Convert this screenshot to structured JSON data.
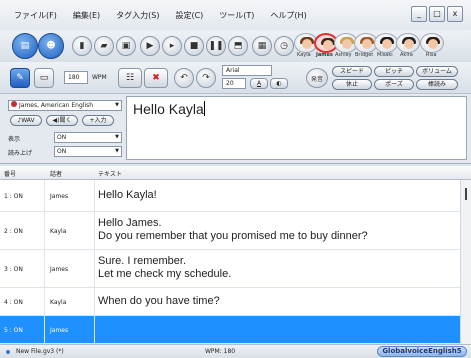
{
  "menu": [
    "ファイル(F)",
    "編集(E)",
    "タグ入力(S)",
    "設定(C)",
    "ツール(T)",
    "ヘルプ(H)"
  ],
  "window_buttons": [
    "_",
    "□",
    "x"
  ],
  "voices": [
    "Kayla",
    "James",
    "Ashley",
    "Bridget",
    "Misaki",
    "Akira",
    "Risa"
  ],
  "selected_voice": "James",
  "toolbar2": {
    "speed_value": "180",
    "wpm_label": "WPM",
    "font_name": "Arial",
    "font_size": "20",
    "speak_label": "発音",
    "speed_btn": "スピード",
    "pitch_btn": "ピッチ",
    "volume_btn": "ボリューム",
    "pause_btn": "休止",
    "pose_btn": "ポーズ",
    "continue_btn": "棒読み"
  },
  "side_panel": {
    "voice_select": "James, American English",
    "wav_btn": "WAV",
    "listen_btn": "聞く",
    "input_btn": "入力",
    "display_label": "表示",
    "display_value": "ON",
    "read_label": "読み上げ",
    "read_value": "ON"
  },
  "editor_text": "Hello Kayla",
  "table": {
    "headers": [
      "番号",
      "話者",
      "テキスト"
    ],
    "rows": [
      {
        "num": "1 : ON",
        "speaker": "James",
        "line1": "Hello Kayla!",
        "line2": ""
      },
      {
        "num": "2 : ON",
        "speaker": "Kayla",
        "line1": "Hello James.",
        "line2": "Do you remember that you promised me to buy dinner?"
      },
      {
        "num": "3 : ON",
        "speaker": "James",
        "line1": "Sure. I remember.",
        "line2": "Let me check my schedule."
      },
      {
        "num": "4 : ON",
        "speaker": "Kayla",
        "line1": "When do you have time?",
        "line2": ""
      },
      {
        "num": "5 : ON",
        "speaker": "James",
        "line1": "",
        "line2": ""
      }
    ]
  },
  "status": {
    "file": "New File.gv3 (*)",
    "wpm": "WPM: 180",
    "brand": "GlobalvoiceEnglish5"
  }
}
